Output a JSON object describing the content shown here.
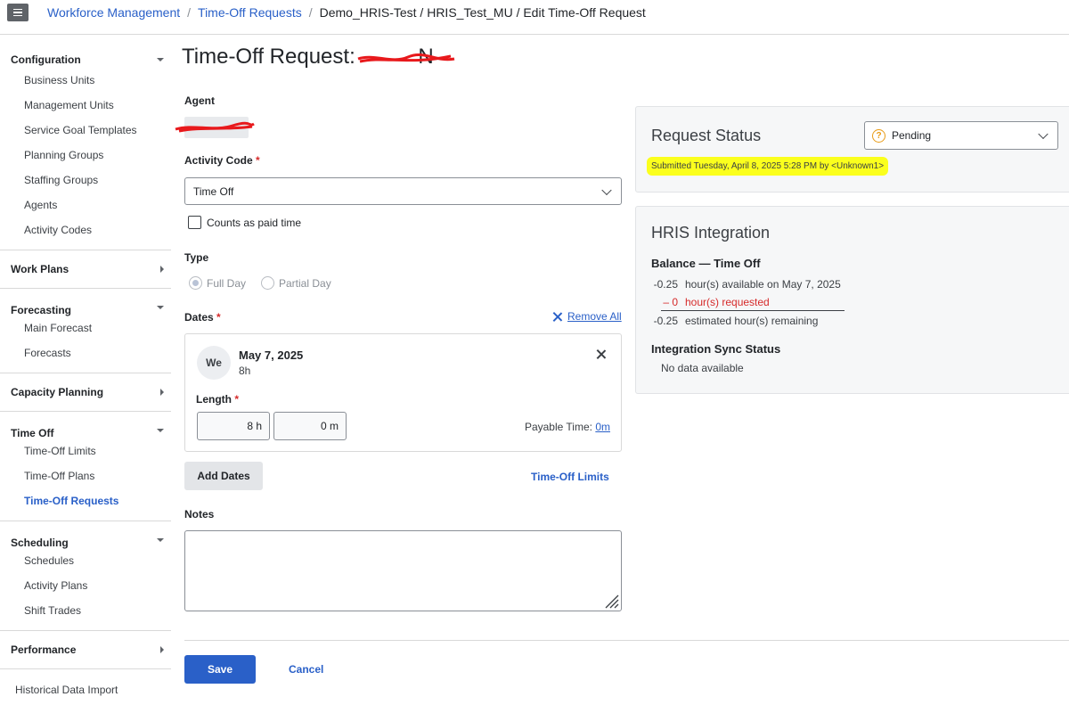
{
  "breadcrumb": {
    "items": [
      "Workforce Management",
      "Time-Off Requests"
    ],
    "current": "Demo_HRIS-Test / HRIS_Test_MU / Edit Time-Off Request",
    "separator": "/"
  },
  "sidebar": {
    "configuration": {
      "title": "Configuration",
      "items": [
        "Business Units",
        "Management Units",
        "Service Goal Templates",
        "Planning Groups",
        "Staffing Groups",
        "Agents",
        "Activity Codes"
      ]
    },
    "work_plans": {
      "title": "Work Plans"
    },
    "forecasting": {
      "title": "Forecasting",
      "items": [
        "Main Forecast",
        "Forecasts"
      ]
    },
    "capacity_planning": {
      "title": "Capacity Planning"
    },
    "time_off": {
      "title": "Time Off",
      "items": [
        "Time-Off Limits",
        "Time-Off Plans",
        "Time-Off Requests"
      ],
      "active": "Time-Off Requests"
    },
    "scheduling": {
      "title": "Scheduling",
      "items": [
        "Schedules",
        "Activity Plans",
        "Shift Trades"
      ]
    },
    "performance": {
      "title": "Performance"
    },
    "historical_import": "Historical Data Import"
  },
  "page": {
    "title": "Time-Off Request: ",
    "title_name": "N"
  },
  "form": {
    "agent_label": "Agent",
    "activity_code_label": "Activity Code",
    "required_mark": "*",
    "activity_code_value": "Time Off",
    "counts_paid_label": "Counts as paid time",
    "type_label": "Type",
    "type_options": [
      "Full Day",
      "Partial Day"
    ],
    "type_selected": "Full Day",
    "dates_label": "Dates",
    "remove_all": "Remove All",
    "date_card": {
      "day_abbr": "We",
      "date": "May 7, 2025",
      "duration": "8h",
      "length_label": "Length",
      "hours_value": "8 h",
      "minutes_value": "0 m",
      "payable_label": "Payable Time:",
      "payable_value": "0m"
    },
    "add_dates": "Add Dates",
    "time_off_limits": "Time-Off Limits",
    "notes_label": "Notes",
    "save": "Save",
    "cancel": "Cancel"
  },
  "request_status": {
    "title": "Request Status",
    "status": "Pending",
    "submitted": "Submitted Tuesday, April 8, 2025 5:28 PM by <Unknown1>"
  },
  "hris": {
    "title": "HRIS Integration",
    "balance_title": "Balance — Time Off",
    "rows": [
      {
        "num": "-0.25",
        "text": "hour(s) available on May 7, 2025"
      },
      {
        "num": "–  0",
        "text": "hour(s) requested"
      },
      {
        "num": "-0.25",
        "text": "estimated hour(s) remaining"
      }
    ],
    "sync_title": "Integration Sync Status",
    "sync_value": "No data available"
  },
  "colors": {
    "link": "#2a60c8",
    "primary_button": "#2a60c8",
    "required": "#d62b2b",
    "pending_icon": "#e89b16",
    "highlight": "#fbff1d",
    "redaction": "#e8191c"
  }
}
